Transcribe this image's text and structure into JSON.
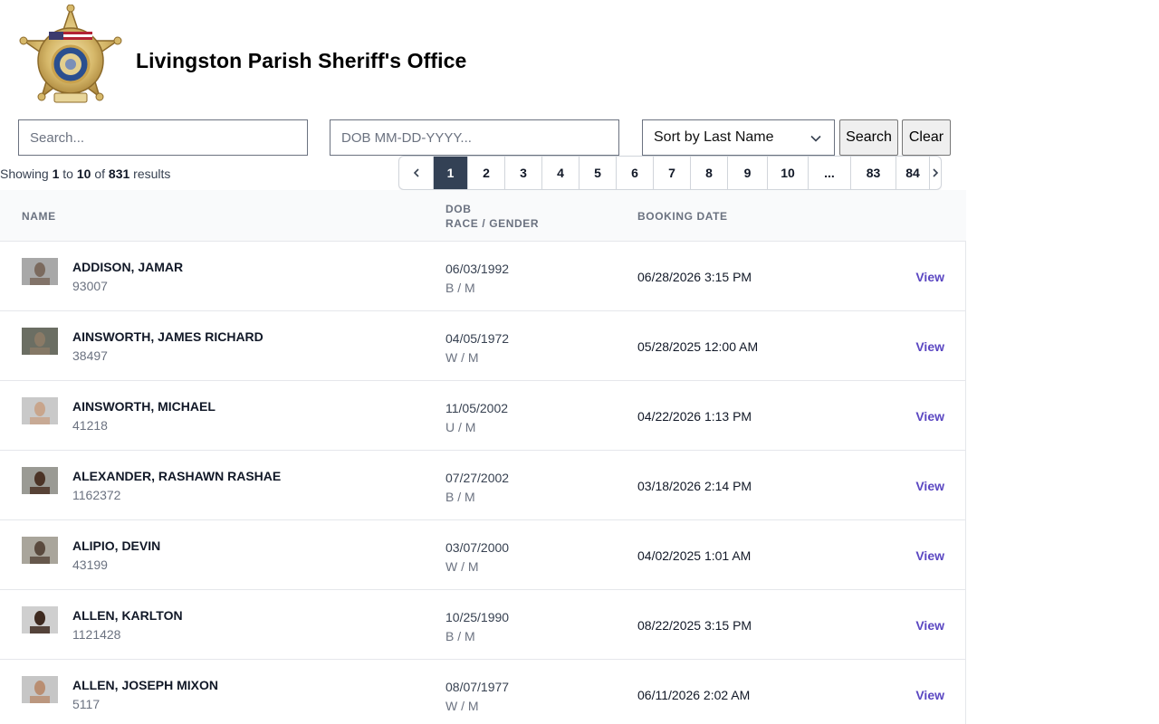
{
  "header": {
    "title": "Livingston Parish Sheriff's Office",
    "badge": {
      "icon": "sheriff-star-badge",
      "text_top": "TO SERVE AND PROTECT",
      "text_mid": "SHERIFF",
      "text_bottom": "LIVINGSTON PARISH",
      "number": "19-4",
      "est": "Est. 1832"
    }
  },
  "filters": {
    "search_placeholder": "Search...",
    "dob_placeholder": "DOB MM-DD-YYYY...",
    "sort_value": "Sort by Last Name",
    "search_label": "Search",
    "clear_label": "Clear"
  },
  "summary": {
    "prefix": "Showing",
    "from": "1",
    "to_word": "to",
    "to": "10",
    "of_word": "of",
    "total": "831",
    "suffix": "results"
  },
  "pagination": {
    "prev_icon": "chevron-left-icon",
    "next_icon": "chevron-right-icon",
    "pages": [
      "1",
      "2",
      "3",
      "4",
      "5",
      "6",
      "7",
      "8",
      "9",
      "10",
      "...",
      "83",
      "84"
    ],
    "current": "1"
  },
  "table": {
    "headers": {
      "name": "NAME",
      "dob": "DOB",
      "race_gender": "RACE / GENDER",
      "booking_date": "BOOKING DATE"
    },
    "view_label": "View",
    "rows": [
      {
        "name": "ADDISON, JAMAR",
        "id": "93007",
        "dob": "06/03/1992",
        "race_gender": "B / M",
        "booking": "06/28/2026 3:15 PM"
      },
      {
        "name": "AINSWORTH, JAMES RICHARD",
        "id": "38497",
        "dob": "04/05/1972",
        "race_gender": "W / M",
        "booking": "05/28/2025 12:00 AM"
      },
      {
        "name": "AINSWORTH, MICHAEL",
        "id": "41218",
        "dob": "11/05/2002",
        "race_gender": "U / M",
        "booking": "04/22/2026 1:13 PM"
      },
      {
        "name": "ALEXANDER, RASHAWN RASHAE",
        "id": "1162372",
        "dob": "07/27/2002",
        "race_gender": "B / M",
        "booking": "03/18/2026 2:14 PM"
      },
      {
        "name": "ALIPIO, DEVIN",
        "id": "43199",
        "dob": "03/07/2000",
        "race_gender": "W / M",
        "booking": "04/02/2025 1:01 AM"
      },
      {
        "name": "ALLEN, KARLTON",
        "id": "1121428",
        "dob": "10/25/1990",
        "race_gender": "B / M",
        "booking": "08/22/2025 3:15 PM"
      },
      {
        "name": "ALLEN, JOSEPH MIXON",
        "id": "5117",
        "dob": "08/07/1977",
        "race_gender": "W / M",
        "booking": "06/11/2026 2:02 AM"
      }
    ]
  },
  "colors": {
    "active_page_bg": "#334155",
    "view_link": "#5b47c2",
    "header_bg": "#f9fafb"
  }
}
